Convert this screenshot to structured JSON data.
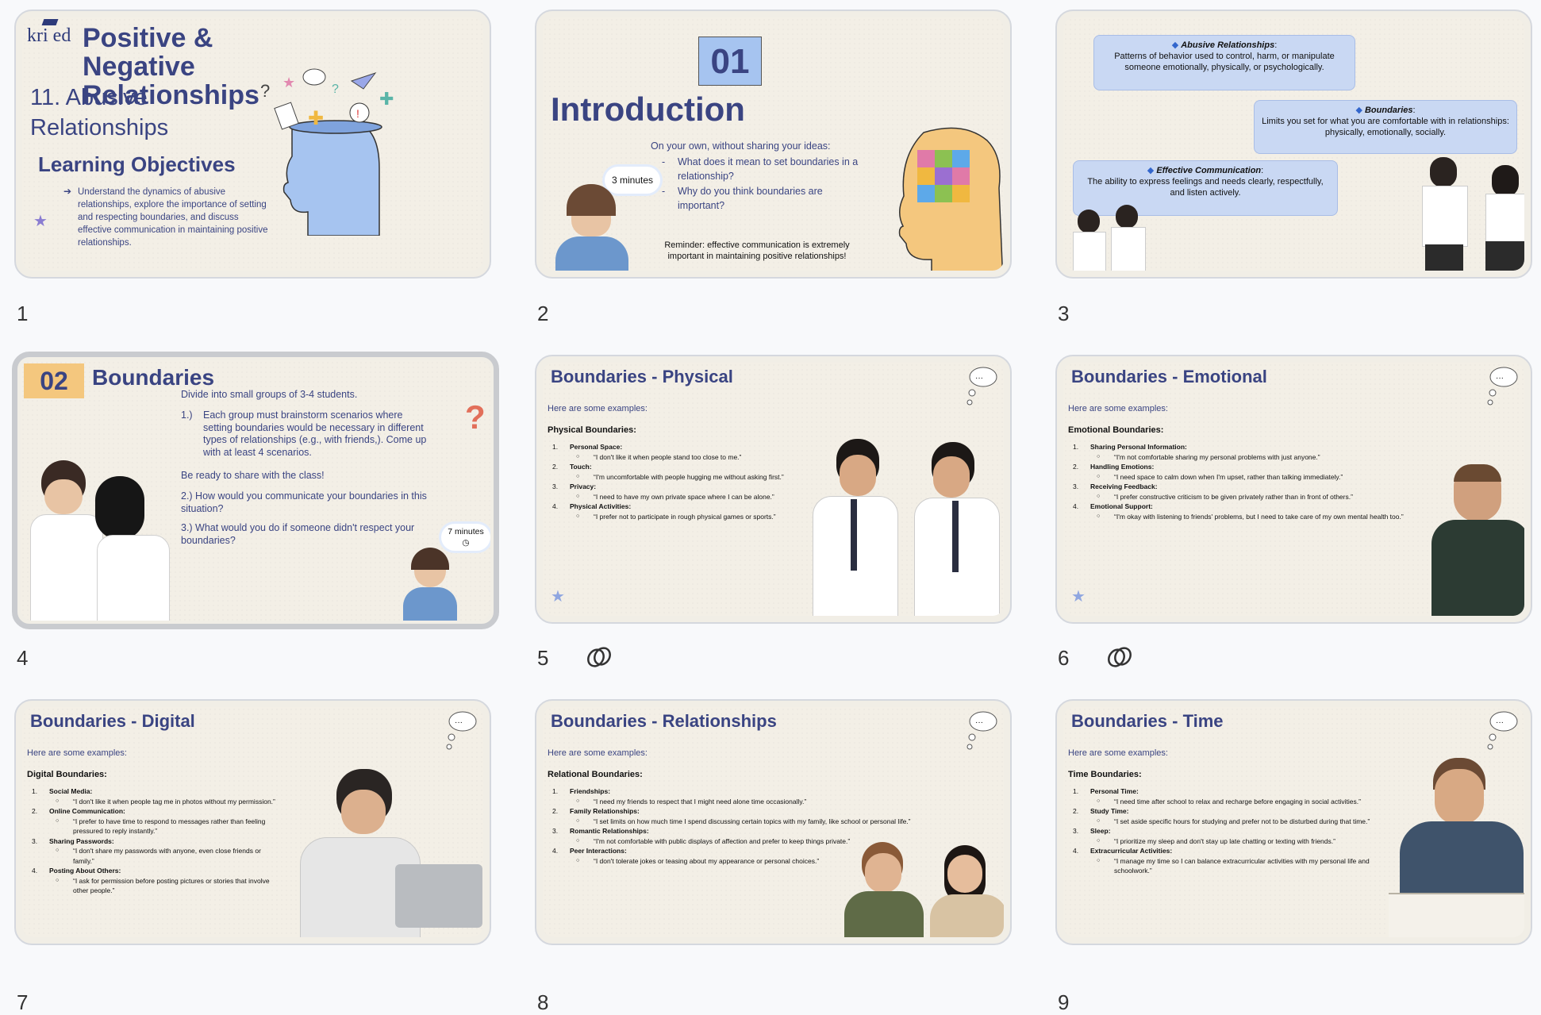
{
  "slides": [
    {
      "number": "1",
      "logo": "kri ed",
      "title": "Positive & Negative Relationships",
      "subtitle": "11. Abusive Relationships",
      "objectives_title": "Learning Objectives",
      "objective_text": "Understand the dynamics of abusive relationships, explore the importance of setting and respecting boundaries, and discuss effective communication in maintaining positive relationships."
    },
    {
      "number": "2",
      "section_number": "01",
      "title": "Introduction",
      "prompt": "On your own, without sharing your ideas:",
      "questions": [
        "What does it mean to set boundaries in a relationship?",
        "Why do you think boundaries are important?"
      ],
      "timer": "3 minutes",
      "reminder": "Reminder: effective communication is extremely important in maintaining positive relationships!"
    },
    {
      "number": "3",
      "defs": [
        {
          "term": "Abusive Relationships",
          "text": "Patterns of behavior used to control, harm, or manipulate someone emotionally, physically, or psychologically."
        },
        {
          "term": "Boundaries",
          "text": "Limits you set for what you are comfortable with in relationships: physically, emotionally, socially."
        },
        {
          "term": "Effective Communication",
          "text": "The ability to express feelings and needs clearly, respectfully, and listen actively."
        }
      ]
    },
    {
      "number": "4",
      "section_number": "02",
      "title": "Boundaries",
      "intro": "Divide into small groups of 3-4 students.",
      "q1_num": "1.)",
      "q1": "Each group must brainstorm scenarios where setting boundaries would be necessary in different types of relationships (e.g., with friends,). Come up with at least 4 scenarios.",
      "ready": "Be ready to share with the class!",
      "q2": "2.) How would you communicate your boundaries in this situation?",
      "q3": "3.) What would you do if someone didn't respect your boundaries?",
      "timer": "7 minutes"
    },
    {
      "number": "5",
      "title": "Boundaries - Physical",
      "sub": "Here are some examples:",
      "heading": "Physical Boundaries:",
      "items": [
        {
          "n": "1.",
          "label": "Personal Space",
          "quote": "“I don't like it when people stand too close to me.”"
        },
        {
          "n": "2.",
          "label": "Touch",
          "quote": "“I'm uncomfortable with people hugging me without asking first.”"
        },
        {
          "n": "3.",
          "label": "Privacy",
          "quote": "“I need to have my own private space where I can be alone.”"
        },
        {
          "n": "4.",
          "label": "Physical Activities",
          "quote": "“I prefer not to participate in rough physical games or sports.”"
        }
      ]
    },
    {
      "number": "6",
      "title": "Boundaries - Emotional",
      "sub": "Here are some examples:",
      "heading": "Emotional Boundaries:",
      "items": [
        {
          "n": "1.",
          "label": "Sharing Personal Information",
          "quote": "“I'm not comfortable sharing my personal problems with just anyone.”"
        },
        {
          "n": "2.",
          "label": "Handling Emotions",
          "quote": "“I need space to calm down when I'm upset, rather than talking immediately.”"
        },
        {
          "n": "3.",
          "label": "Receiving Feedback",
          "quote": "“I prefer constructive criticism to be given privately rather than in front of others.”"
        },
        {
          "n": "4.",
          "label": "Emotional Support",
          "quote": "“I'm okay with listening to friends' problems, but I need to take care of my own mental health too.”"
        }
      ]
    },
    {
      "number": "7",
      "title": "Boundaries - Digital",
      "sub": "Here are some examples:",
      "heading": "Digital Boundaries:",
      "items": [
        {
          "n": "1.",
          "label": "Social Media",
          "quote": "“I don't like it when people tag me in photos without my permission.”"
        },
        {
          "n": "2.",
          "label": "Online Communication",
          "quote": "“I prefer to have time to respond to messages rather than feeling pressured to reply instantly.”"
        },
        {
          "n": "3.",
          "label": "Sharing Passwords",
          "quote": "“I don't share my passwords with anyone, even close friends or family.”"
        },
        {
          "n": "4.",
          "label": "Posting About Others",
          "quote": "“I ask for permission before posting pictures or stories that involve other people.”"
        }
      ]
    },
    {
      "number": "8",
      "title": "Boundaries - Relationships",
      "sub": "Here are some examples:",
      "heading": "Relational Boundaries:",
      "items": [
        {
          "n": "1.",
          "label": "Friendships",
          "quote": "“I need my friends to respect that I might need alone time occasionally.”"
        },
        {
          "n": "2.",
          "label": "Family Relationships",
          "quote": "“I set limits on how much time I spend discussing certain topics with my family, like school or personal life.”"
        },
        {
          "n": "3.",
          "label": "Romantic Relationships",
          "quote": "“I'm not comfortable with public displays of affection and prefer to keep things private.”"
        },
        {
          "n": "4.",
          "label": "Peer Interactions",
          "quote": "“I don't tolerate jokes or teasing about my appearance or personal choices.”"
        }
      ]
    },
    {
      "number": "9",
      "title": "Boundaries - Time",
      "sub": "Here are some examples:",
      "heading": "Time Boundaries:",
      "items": [
        {
          "n": "1.",
          "label": "Personal Time",
          "quote": "“I need time after school to relax and recharge before engaging in social activities.”"
        },
        {
          "n": "2.",
          "label": "Study Time",
          "quote": "“I set aside specific hours for studying and prefer not to be disturbed during that time.”"
        },
        {
          "n": "3.",
          "label": "Sleep",
          "quote": "“I prioritize my sleep and don't stay up late chatting or texting with friends.”"
        },
        {
          "n": "4.",
          "label": "Extracurricular Activities",
          "quote": "“I manage my time so I can balance extracurricular activities with my personal life and schoolwork.”"
        }
      ]
    }
  ],
  "colors": {
    "navy": "#3a4482",
    "blue_bubble": "#c9d8f3",
    "orange": "#f4c77e",
    "head_blue": "#a6c4f0"
  }
}
